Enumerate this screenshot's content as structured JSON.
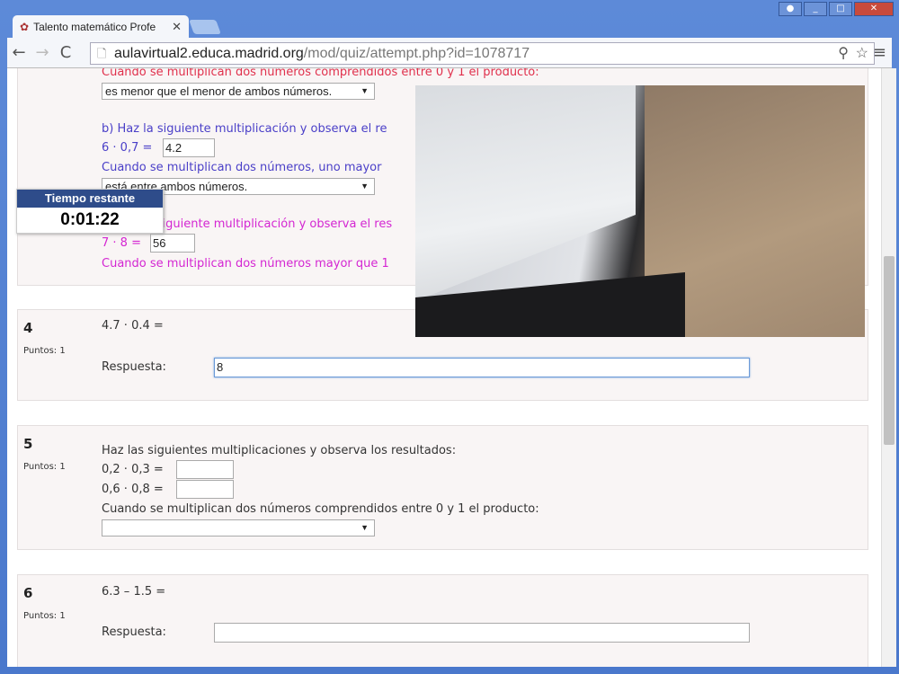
{
  "browser": {
    "tab_title": "Talento matemático Profe",
    "url_host": "aulavirtual2.educa.madrid.org",
    "url_path": "/mod/quiz/attempt.php?id=1078717"
  },
  "timer": {
    "label": "Tiempo restante",
    "value": "0:01:22"
  },
  "q3": {
    "line_a": "Cuando se multiplican dos números comprendidos entre 0 y 1 el producto:",
    "select_a": "es menor que el menor de ambos números.",
    "b_instr": "b) Haz la siguiente multiplicación y observa el re",
    "b_expr": "6 · 0,7 =",
    "b_value": "4.2",
    "b_line": "Cuando se multiplican dos números, uno mayor",
    "select_b": "está entre ambos números.",
    "c_instr": "c) Haz la siguiente multiplicación y observa el res",
    "c_expr": "7 · 8 =",
    "c_value": "56",
    "c_line": "Cuando se multiplican dos números mayor que 1"
  },
  "q4": {
    "number": "4",
    "points": "Puntos: 1",
    "expr": "4.7 · 0.4 =",
    "answer_label": "Respuesta:",
    "answer_value": "8"
  },
  "q5": {
    "number": "5",
    "points": "Puntos: 1",
    "instr": "Haz las siguientes multiplicaciones y observa los resultados:",
    "expr1": "0,2 · 0,3 =",
    "expr2": "0,6 · 0,8 =",
    "line": "Cuando se multiplican dos números comprendidos entre 0 y 1 el producto:",
    "select": ""
  },
  "q6": {
    "number": "6",
    "points": "Puntos: 1",
    "expr": "6.3 – 1.5 =",
    "answer_label": "Respuesta:",
    "answer_value": ""
  }
}
